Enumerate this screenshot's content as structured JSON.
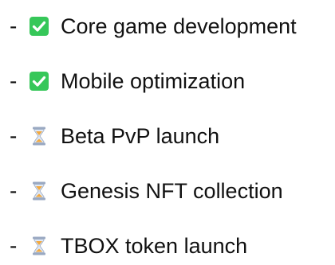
{
  "colors": {
    "check_green": "#36c759",
    "hourglass_frame": "#9aa9c2",
    "hourglass_sand": "#f3a93f",
    "text": "#111111"
  },
  "items": [
    {
      "bullet": "-",
      "icon": "check-mark-button-icon",
      "label": "Core game development"
    },
    {
      "bullet": "-",
      "icon": "check-mark-button-icon",
      "label": "Mobile optimization"
    },
    {
      "bullet": "-",
      "icon": "hourglass-icon",
      "label": "Beta PvP launch"
    },
    {
      "bullet": "-",
      "icon": "hourglass-icon",
      "label": "Genesis NFT collection"
    },
    {
      "bullet": "-",
      "icon": "hourglass-icon",
      "label": "TBOX token launch"
    }
  ]
}
